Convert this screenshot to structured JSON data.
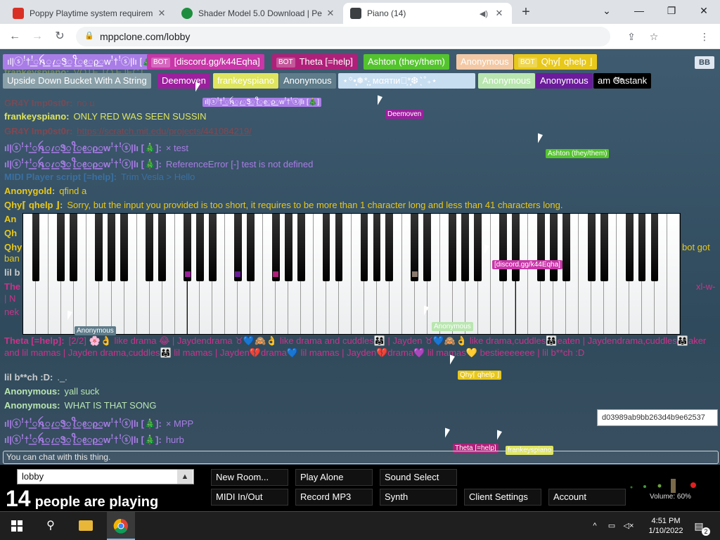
{
  "tabs": [
    {
      "title": "Poppy Playtime system requirem",
      "close": "✕",
      "fav_color": "#d93025",
      "fav_glyph": "▶"
    },
    {
      "title": "Shader Model 5.0 Download | Pe",
      "close": "✕",
      "fav_color": "#1e8e3e",
      "fav_glyph": "●"
    },
    {
      "title": "Piano (14)",
      "close": "✕",
      "fav_color": "#3c4043",
      "fav_glyph": "▥"
    }
  ],
  "new_tab": "+",
  "window_controls": {
    "collapse": "⌄",
    "minimize": "—",
    "restore": "❐",
    "close": "✕"
  },
  "address": {
    "url": "mppclone.com/lobby",
    "lock": "🔒"
  },
  "nav": {
    "back": "←",
    "forward": "→",
    "reload": "↻"
  },
  "toolbar_icons": {
    "share": "⇪",
    "star": "☆",
    "menu": "⋮"
  },
  "users": [
    {
      "label": "ıl|ⓢꜝ†ꜝ꯭ꫝ꯭ꪹ꯭Ꮥ꯭ꪻ꯭ꫀ꯭ρ꯭꯭ᴡꜝ†ꜝⓢ|lı [🎄]",
      "color": "#a97de6",
      "text": "#ffffff",
      "bot": false
    },
    {
      "label": "[discord.gg/k44Eqha]",
      "color": "#c836a8",
      "text": "#ffffff",
      "bot": true
    },
    {
      "label": "Theta [=help]",
      "color": "#b0207a",
      "text": "#ffffff",
      "bot": true
    },
    {
      "label": "Ashton (they/them)",
      "color": "#54c42e",
      "text": "#ffffff",
      "bot": false
    },
    {
      "label": "Anonymous",
      "color": "#f3c9a5",
      "text": "#ffffff",
      "bot": false
    },
    {
      "label": "Qhy⌈ qhelp ⌋",
      "color": "#e8c81a",
      "text": "#ffffff",
      "bot": true
    },
    {
      "label": "Upside Down Bucket With A String",
      "color": "#8aa0a9",
      "text": "#ffffff",
      "bot": false
    },
    {
      "label": "Deemoven",
      "color": "#9c1f9e",
      "text": "#ffffff",
      "bot": false
    },
    {
      "label": "frankeyspiano",
      "color": "#dfe55e",
      "text": "#ffffff",
      "bot": false
    },
    {
      "label": "Anonymous",
      "color": "#5e7c8a",
      "text": "#ffffff",
      "bot": false
    },
    {
      "label": "⋆꙳•̩̩͙❅*̩̩͙‧͙ мαятιи‧͙*̩̩͙❆ ͙͛ ˚₊⋆",
      "color": "#c7ddf0",
      "text": "#ffffff",
      "bot": false
    },
    {
      "label": "Anonymous",
      "color": "#b9e6b0",
      "text": "#ffffff",
      "bot": false
    },
    {
      "label": "Anonymous",
      "color": "#6a1c9a",
      "text": "#ffffff",
      "bot": false
    },
    {
      "label": "am Gastank",
      "color": "#000000",
      "text": "#ffffff",
      "bot": false
    }
  ],
  "me_label": "Me",
  "bot_badge": "BOT",
  "bb_button": "BB",
  "chat": [
    {
      "name": "frankeyspiano:",
      "text": "VOTE TO EJECT",
      "color": "#dfe55e",
      "faded": true
    },
    {
      "name": "GR4Y Imp0st0r:",
      "text": "no u",
      "color": "#c63b3b",
      "faded": true
    },
    {
      "name": "frankeyspiano:",
      "text": "ONLY RED WAS SEEN SUSSIN",
      "color": "#dfe55e",
      "faded": false
    },
    {
      "name": "GR4Y Imp0st0r:",
      "text": "https://scratch.mit.edu/projects/441084219/",
      "color": "#c63b3b",
      "faded": true
    },
    {
      "name": "ıl|ⓢꜝ†ꜝ꯭ꫝ꯭ꪹ꯭Ꮥ꯭ꪻ꯭ꫀ꯭ρ꯭꯭ᴡꜝ†ꜝⓢ|lı [🎄]:",
      "text": "× test",
      "color": "#a97de6",
      "faded": false
    },
    {
      "name": "ıl|ⓢꜝ†ꜝ꯭ꫝ꯭ꪹ꯭Ꮥ꯭ꪻ꯭ꫀ꯭ρ꯭꯭ᴡꜝ†ꜝⓢ|lı [🎄]:",
      "text": "ReferenceError [-] test is not defined",
      "color": "#a97de6",
      "faded": false
    },
    {
      "name": "MIDI Player script [=help]:",
      "text": "Trim Vesla > Hello",
      "color": "#3b8de0",
      "faded": true
    },
    {
      "name": "Anonygold:",
      "text": "qfind a",
      "color": "#e8c81a",
      "faded": false
    },
    {
      "name": "Qhy⌈ qhelp ⌋:",
      "text": "Sorry, but the input you provided is too short, it requires to be more than 1 character long and less than 41 characters long.",
      "color": "#e8c81a",
      "faded": false
    },
    {
      "name": "Theta [=help]:",
      "text": "[2/2] 🌸👌 like drama 😂 | Jaydendrama ♉💙🙈👌 like drama and cuddles👨‍👩‍👧 | Jayden ♉💙🙈👌 like drama,cuddles👨‍👩‍👧eaten | Jaydendrama,cuddles👨‍👩‍👧aker and lil mamas | Jayden drama,cuddles👨‍👩‍👧 lil mamas | Jayden💔drama💙 lil mamas | Jayden💔drama💜 lil mamas💛 bestieeeeeee | lil b**ch :D",
      "color": "#c7358a",
      "faded": false
    },
    {
      "name": "lil b**ch :D:",
      "text": "._.",
      "color": "#cccccc",
      "faded": false
    },
    {
      "name": "Anonymous:",
      "text": "yall suck",
      "color": "#b9e6b0",
      "faded": false
    },
    {
      "name": "Anonymous:",
      "text": "WHAT IS THAT SONG",
      "color": "#b9e6b0",
      "faded": false
    },
    {
      "name": "ıl|ⓢꜝ†ꜝ꯭ꫝ꯭ꪹ꯭Ꮥ꯭ꪻ꯭ꫀ꯭ρ꯭꯭ᴡꜝ†ꜝⓢ|lı [🎄]:",
      "text": "× MPP",
      "color": "#a97de6",
      "faded": false
    },
    {
      "name": "ıl|ⓢꜝ†ꜝ꯭ꫝ꯭ꪹ꯭Ꮥ꯭ꪻ꯭ꫀ꯭ρ꯭꯭ᴡꜝ†ꜝⓢ|lı [🎄]:",
      "text": "hurb",
      "color": "#a97de6",
      "faded": false
    }
  ],
  "hidden_chat_fragments": {
    "an1": "An",
    "qh1": "Qh",
    "qh2": "Qhy",
    "ban": "ban",
    "lil": "lil b",
    "the": "The",
    "n1": "| N",
    "nek": "nek",
    "bot_got": "bot got",
    "xl": "xl-w-"
  },
  "cursor_tags": [
    {
      "label": "ıl|ⓢꜝ†ꜝ꯭ꫝ꯭ꪹ꯭Ꮥ꯭ꪻ꯭ꫀ꯭ρ꯭꯭ᴡꜝ†ꜝⓢ|lı [🎄]",
      "color": "#a97de6"
    },
    {
      "label": "Deemoven",
      "color": "#9c1f9e"
    },
    {
      "label": "Ashton (they/them)",
      "color": "#54c42e"
    },
    {
      "label": "[discord.gg/k44Eqha]",
      "color": "#c836a8"
    },
    {
      "label": "Anonymous",
      "color": "#5e7c8a"
    },
    {
      "label": "Anonymous",
      "color": "#b9e6b0"
    },
    {
      "label": "Qhy⌈ qhelp ⌋",
      "color": "#e8c81a"
    },
    {
      "label": "Theta [=help]",
      "color": "#b0207a"
    },
    {
      "label": "frankeyspiano",
      "color": "#dfe55e"
    }
  ],
  "session_hash": "d03989ab9bb263d4b9e62537",
  "chat_placeholder": "You can chat with this thing.",
  "room": {
    "name": "lobby",
    "arrow": "▲"
  },
  "people": {
    "count": "14",
    "label": "people are playing"
  },
  "controls": {
    "new_room": "New Room...",
    "play_alone": "Play Alone",
    "sound_select": "Sound Select",
    "midi": "MIDI In/Out",
    "record": "Record MP3",
    "synth": "Synth",
    "client_settings": "Client Settings",
    "account": "Account"
  },
  "volume": {
    "label": "Volume: 60%",
    "level": 0.6
  },
  "taskbar": {
    "time": "4:51 PM",
    "date": "1/10/2022",
    "notif_count": "2"
  }
}
